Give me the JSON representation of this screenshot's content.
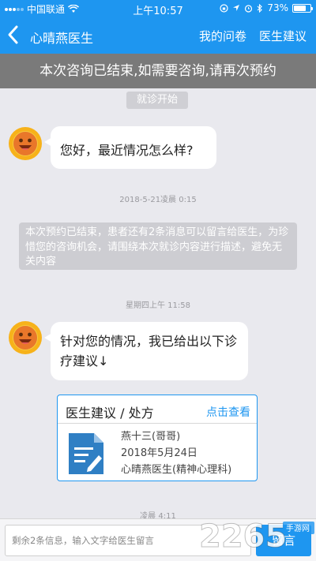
{
  "status_bar": {
    "carrier": "中国联通",
    "time": "上午10:57",
    "battery": "73%",
    "battery_level": 0.73
  },
  "nav": {
    "title": "心晴燕医生",
    "actions": [
      "我的问卷",
      "医生建议"
    ]
  },
  "banner": {
    "text": "本次咨询已结束,如需要咨询,请再次预约"
  },
  "chat": {
    "start_chip": "就诊开始",
    "msg1": "您好，最近情况怎么样?",
    "ts1": "2018-5-21凌晨 0:15",
    "system": "本次预约已结束，患者还有2条消息可以留言给医生，为珍惜您的咨询机会，请围绕本次就诊内容进行描述，避免无关内容",
    "ts2": "星期四上午 11:58",
    "msg2": "针对您的情况，我已给出以下诊疗建议↓",
    "ts3": "凌晨 4:11"
  },
  "card": {
    "title": "医生建议 / 处方",
    "link": "点击查看",
    "patient": "燕十三(哥哥)",
    "date": "2018年5月24日",
    "doctor": "心晴燕医生(精神心理科)"
  },
  "composer": {
    "placeholder": "剩余2条信息，输入文字给医生留言",
    "send_label": "留言"
  },
  "watermark": {
    "text": "2265",
    "sub": "手游网"
  },
  "colors": {
    "primary": "#1e96f0",
    "banner": "#7a7a7a",
    "bg": "#e9e9ee"
  },
  "icons": [
    "back-icon",
    "wifi-icon",
    "location-icon",
    "alarm-icon",
    "bluetooth-icon",
    "battery-icon",
    "avatar-icon",
    "document-icon"
  ]
}
